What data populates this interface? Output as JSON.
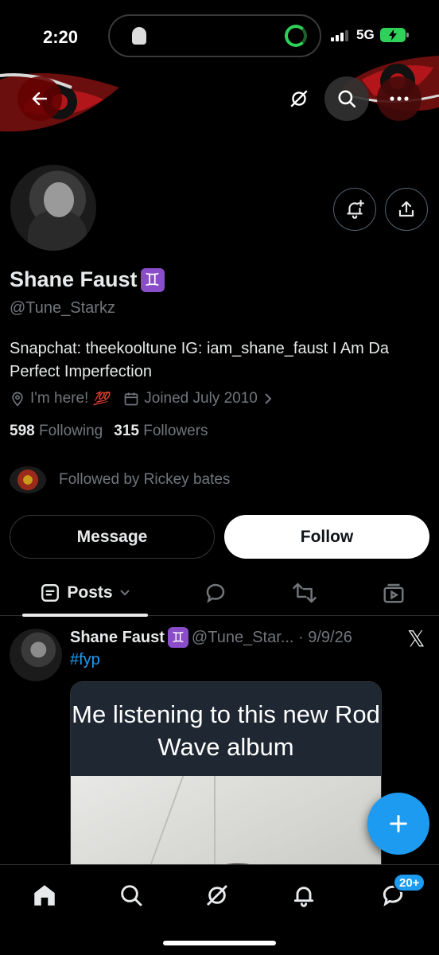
{
  "status_bar": {
    "time": "2:20",
    "network": "5G"
  },
  "profile": {
    "name": "Shane Faust",
    "badge_glyph": "♊",
    "handle": "@Tune_Starkz",
    "bio": "Snapchat: theekooltune IG: iam_shane_faust I Am Da Perfect Imperfection",
    "location": "I'm here!",
    "location_emoji": "💯",
    "joined": "Joined July 2010",
    "following_count": "598",
    "following_label": "Following",
    "followers_count": "315",
    "followers_label": "Followers",
    "followed_by": "Followed by Rickey bates"
  },
  "actions": {
    "message": "Message",
    "follow": "Follow"
  },
  "tabs": {
    "posts": "Posts"
  },
  "post": {
    "name": "Shane Faust",
    "badge_glyph": "♊",
    "handle_date": "@Tune_Star... · 9/9/26",
    "text": "#fyp",
    "media_caption": "Me listening to this new Rod Wave album"
  },
  "nav": {
    "messages_badge": "20+"
  },
  "colors": {
    "accent": "#1d9bf0",
    "background": "#000000",
    "secondary_text": "#71767b"
  },
  "icons": [
    "back-arrow-icon",
    "grok-icon",
    "search-icon",
    "more-icon",
    "bell-plus-icon",
    "share-icon",
    "location-icon",
    "calendar-icon",
    "chevron-right-icon",
    "posts-icon",
    "reply-icon",
    "repost-icon",
    "media-icon",
    "x-logo-icon",
    "plus-icon",
    "home-icon",
    "notifications-icon",
    "messages-icon"
  ]
}
